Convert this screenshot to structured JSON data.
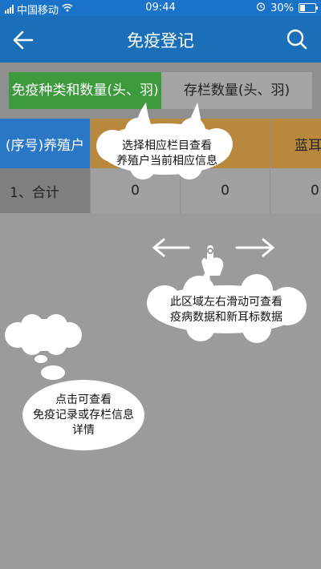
{
  "status_bar": {
    "carrier": "中国移动",
    "time": "09:44",
    "battery": "30%"
  },
  "app_bar": {
    "title": "免疫登记",
    "back_icon": "back-arrow-icon",
    "search_icon": "search-icon"
  },
  "tabs": [
    {
      "label": "免疫种类和数量(头、羽)",
      "selected": true
    },
    {
      "label": "存栏数量(头、羽)",
      "selected": false
    }
  ],
  "table": {
    "headers": [
      "(序号)养殖户",
      "",
      "蓝",
      "蓝耳"
    ],
    "rows": [
      [
        "1、合计",
        "0",
        "0",
        "0"
      ]
    ]
  },
  "hints": {
    "top_bubble_line1": "选择相应栏目查看",
    "top_bubble_line2": "养殖户当前相应信息",
    "swipe_line1": "此区域左右滑动可查看",
    "swipe_line2": "疫病数据和新耳标数据",
    "tap_line1": "点击可查看",
    "tap_line2": "免疫记录或存栏信息",
    "tap_line3": "详情"
  },
  "colors": {
    "status_bar": "#1a72c9",
    "app_bar": "#1a6fb8",
    "tab_selected": "#3d9a3d",
    "tab_unselected": "#a5a5a5",
    "header_primary": "#2a78c5",
    "header_secondary": "#b8893d",
    "overlay": "#9b9b9b"
  }
}
